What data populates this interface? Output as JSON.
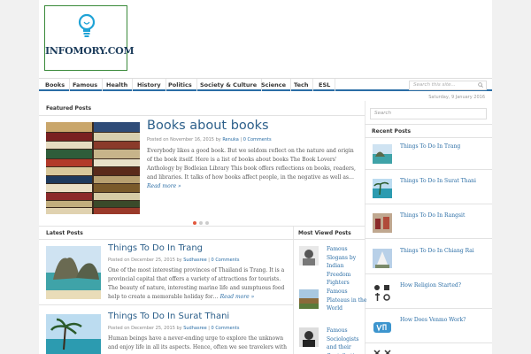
{
  "site": {
    "logo_text": "INFOMORY.COM"
  },
  "nav": {
    "items": [
      "Books",
      "Famous",
      "Health",
      "History",
      "Politics",
      "Society & Culture",
      "Science",
      "Tech",
      "ESL"
    ],
    "search_placeholder": "Search this site..."
  },
  "date": "Saturday, 9 January 2016",
  "featured": {
    "section_title": "Featured Posts",
    "title": "Books about books",
    "meta_prefix": "Posted on November 16, 2015 by",
    "author": "Renuka",
    "comments": "0 Comments",
    "excerpt": "Everybody likes a good book. But we seldom reflect on the nature and origin of the book itself. Here is a list of books about books The Book Lovers' Anthology by Bodleian Library This book offers reflections on books, readers, and libraries. It talks of how books affect people, in the negative as well as…",
    "read_more": "Read more »"
  },
  "latest": {
    "section_title": "Latest Posts",
    "posts": [
      {
        "title": "Things To Do In Trang",
        "meta_prefix": "Posted on December 25, 2015 by",
        "author": "Sudhasree",
        "comments": "0 Comments",
        "excerpt": "One of the most interesting provinces of Thailand is Trang. It is a provincial capital that offers a variety of attractions for tourists. The beauty of nature, interesting marine life and sumptuous food help to create a memorable holiday for…",
        "read_more": "Read more »"
      },
      {
        "title": "Things To Do In Surat Thani",
        "meta_prefix": "Posted on December 25, 2015 by",
        "author": "Sudhasree",
        "comments": "0 Comments",
        "excerpt": "Human beings have a never-ending urge to explore the unknown and enjoy life in all its aspects. Hence, often we see travelers with"
      }
    ]
  },
  "most_viewed": {
    "section_title": "Most Viewd Posts",
    "items": [
      "Famous Slogans by Indian Freedom Fighters",
      "Famous Plateaus in the World",
      "Famous Sociologists and their Contributions"
    ]
  },
  "sidebar": {
    "search_placeholder": "Search",
    "recent_title": "Recent Posts",
    "recent": [
      "Things To Do In Trang",
      "Things To Do In Surat Thani",
      "Things To Do In Rangsit",
      "Things To Do In Chiang Rai",
      "How Religion Started?",
      "How Does Venmo Work?"
    ]
  },
  "colors": {
    "accent": "#2a6da5",
    "link": "#2c5f8a",
    "dot_active": "#e2583e"
  }
}
